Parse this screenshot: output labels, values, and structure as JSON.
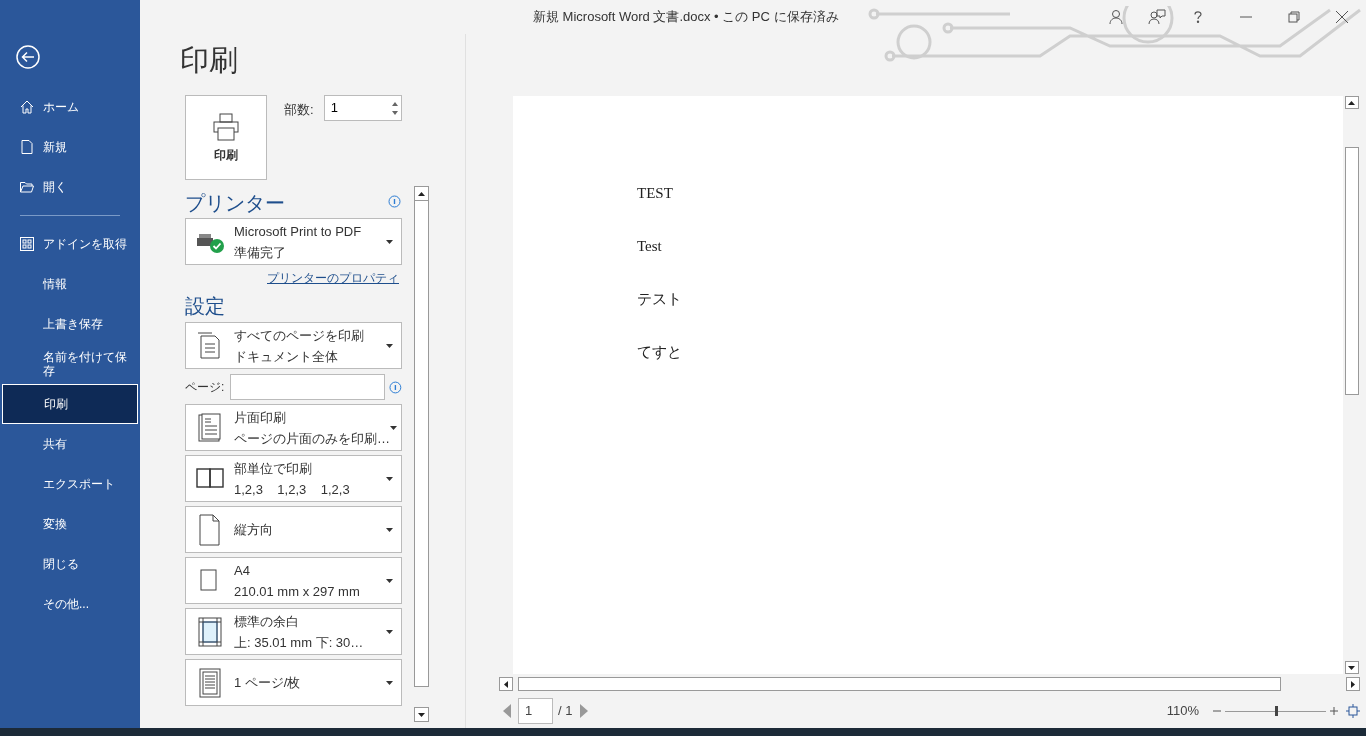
{
  "window": {
    "title": "新規 Microsoft Word 文書.docx • この PC に保存済み"
  },
  "sidebar": {
    "groups": [
      [
        {
          "label": "ホーム",
          "kind": "home",
          "selected": false
        },
        {
          "label": "新規",
          "kind": "new",
          "selected": false
        },
        {
          "label": "開く",
          "kind": "open",
          "selected": false
        }
      ],
      [
        {
          "label": "アドインを取得",
          "kind": "addins",
          "selected": false
        },
        {
          "label": "情報",
          "kind": "plain",
          "selected": false
        },
        {
          "label": "上書き保存",
          "kind": "plain",
          "selected": false
        },
        {
          "label": "名前を付けて保存",
          "kind": "plain",
          "selected": false
        },
        {
          "label": "印刷",
          "kind": "plain",
          "selected": true
        },
        {
          "label": "共有",
          "kind": "plain",
          "selected": false
        },
        {
          "label": "エクスポート",
          "kind": "plain",
          "selected": false
        },
        {
          "label": "変換",
          "kind": "plain",
          "selected": false
        },
        {
          "label": "閉じる",
          "kind": "plain",
          "selected": false
        },
        {
          "label": "その他...",
          "kind": "plain",
          "selected": false
        }
      ]
    ]
  },
  "print": {
    "heading": "印刷",
    "button": "印刷",
    "copies": {
      "label": "部数:",
      "value": "1"
    }
  },
  "printer": {
    "heading": "プリンター",
    "name": "Microsoft Print to PDF",
    "status": "準備完了",
    "properties_link": "プリンターのプロパティ"
  },
  "settings": {
    "heading": "設定",
    "scope": {
      "kind": "pages",
      "line1": "すべてのページを印刷",
      "line2": "ドキュメント全体"
    },
    "page_range": {
      "label": "ページ:"
    },
    "options": [
      {
        "kind": "one-sided",
        "line1": "片面印刷",
        "line2": "ページの片面のみを印刷…"
      },
      {
        "kind": "collated",
        "line1": "部単位で印刷",
        "line2": "1,2,3    1,2,3    1,2,3"
      },
      {
        "kind": "portrait",
        "line1": "縦方向"
      },
      {
        "kind": "paper",
        "line1": "A4",
        "line2": "210.01 mm x 297 mm"
      },
      {
        "kind": "margins",
        "line1": "標準の余白",
        "line2": "上: 35.01 mm 下: 30…"
      },
      {
        "kind": "per-sheet",
        "line1": "1 ページ/枚"
      }
    ]
  },
  "preview": {
    "lines": [
      "TEST",
      "Test",
      "テスト",
      "てすと"
    ],
    "page_nav": {
      "current": "1",
      "total": "/ 1"
    },
    "zoom": {
      "reading": "110%",
      "level": 0.5
    }
  }
}
